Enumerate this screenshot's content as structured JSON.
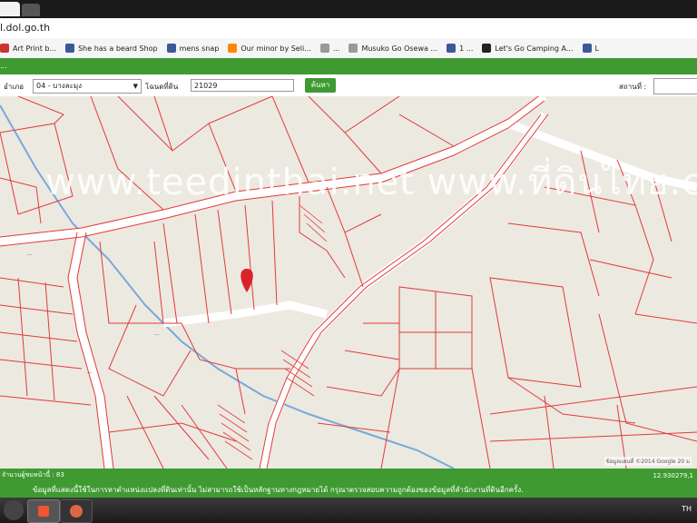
{
  "browser": {
    "url": "l.dol.go.th",
    "bookmarks": [
      {
        "label": "Art Print b...",
        "icon": "bookmark-icon",
        "color": "#c33"
      },
      {
        "label": "She has a beard Shop",
        "icon": "facebook-icon",
        "color": "#3b5998"
      },
      {
        "label": "mens snap",
        "icon": "facebook-icon",
        "color": "#3b5998"
      },
      {
        "label": "Our minor by Seli...",
        "icon": "rss-icon",
        "color": "#f80"
      },
      {
        "label": "...",
        "icon": "site-icon",
        "color": "#999"
      },
      {
        "label": "Musuko Go Osewa ...",
        "icon": "doc-icon",
        "color": "#999"
      },
      {
        "label": "1 ...",
        "icon": "facebook-icon",
        "color": "#3b5998"
      },
      {
        "label": "Let's Go Camping A...",
        "icon": "site-icon",
        "color": "#222"
      },
      {
        "label": "L",
        "icon": "facebook-icon",
        "color": "#3b5998"
      }
    ]
  },
  "header": {
    "title": "..."
  },
  "form": {
    "district_label": "อำเภอ",
    "district_value": "04 - บางละมุง",
    "parcel_label": "โฉนดที่ดิน",
    "parcel_value": "21029",
    "search_button": "ค้นหา",
    "status_label": "สถานที่ :"
  },
  "map": {
    "watermark": "www.teedinthai.net www.ที่ดินไทย.com",
    "copyright": "ข้อมูลแผนที่ ©2014 Google   20 ม",
    "road_label_1": "...",
    "road_label_2": "...",
    "road_label_3": "..."
  },
  "footer": {
    "count_text": "จำนวนผู้ชมหน้านี้ : 83",
    "disclaimer": "ข้อมูลที่แสดงนี้ใช้ในการหาตำแหน่งแปลงที่ดินเท่านั้น ไม่สามารถใช้เป็นหลักฐานทางกฎหมายได้ กรุณาตรวจสอบความถูกต้องของข้อมูลที่สำนักงานที่ดินอีกครั้ง.",
    "coordinates": "12.930279,1"
  },
  "taskbar": {
    "lang": "TH"
  },
  "colors": {
    "green": "#3f9a32",
    "parcel_line": "#e23a3a",
    "marker": "#d9232a"
  }
}
